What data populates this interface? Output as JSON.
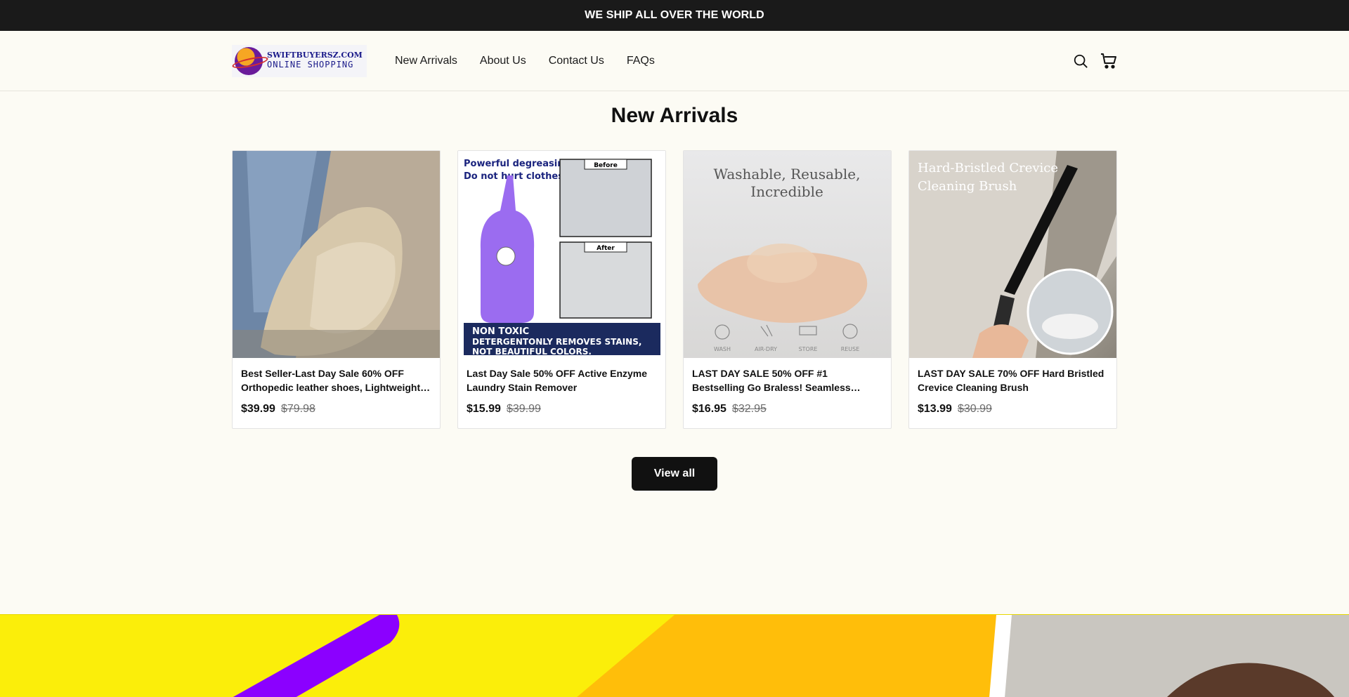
{
  "announcement": "WE SHIP ALL OVER THE WORLD",
  "logo": {
    "site": "SWIFTBUYERSZ.COM",
    "tagline": "ONLINE SHOPPING"
  },
  "nav": [
    "New Arrivals",
    "About Us",
    "Contact Us",
    "FAQs"
  ],
  "icons": {
    "search": "search-icon",
    "cart": "cart-icon"
  },
  "section": {
    "title": "New Arrivals"
  },
  "products": [
    {
      "title": "Best Seller-Last Day Sale 60% OFF Orthopedic leather shoes, Lightweight…",
      "price": "$39.99",
      "compare": "$79.98",
      "image_text": []
    },
    {
      "title": " Last Day Sale 50% OFF  Active Enzyme Laundry Stain Remover",
      "price": "$15.99",
      "compare": "$39.99",
      "image_text": [
        "Powerful degreasing",
        "Do not hurt clothes",
        "Before",
        "After",
        "NON TOXIC",
        "DETERGENTONLY REMOVES STAINS,",
        "NOT BEAUTIFUL COLORS."
      ]
    },
    {
      "title": " LAST DAY SALE 50% OFF  #1 Bestselling  Go Braless! Seamless…",
      "price": "$16.95",
      "compare": "$32.95",
      "image_text": [
        "Washable, Reusable,",
        "Incredible",
        "WASH",
        "AIR-DRY",
        "STORE",
        "REUSE"
      ]
    },
    {
      "title": " LAST DAY SALE 70% OFF  Hard Bristled Crevice Cleaning Brush",
      "price": "$13.99",
      "compare": "$30.99",
      "image_text": [
        "Hard-Bristled Crevice",
        "Cleaning Brush"
      ]
    }
  ],
  "view_all": "View all",
  "colors": {
    "background": "#fcfbf4",
    "announcement_bg": "#1a1a1a",
    "button_bg": "#111111",
    "banner_yellow": "#fbee0a",
    "banner_purple": "#8b00ff",
    "banner_orange": "#ffbe0a"
  }
}
